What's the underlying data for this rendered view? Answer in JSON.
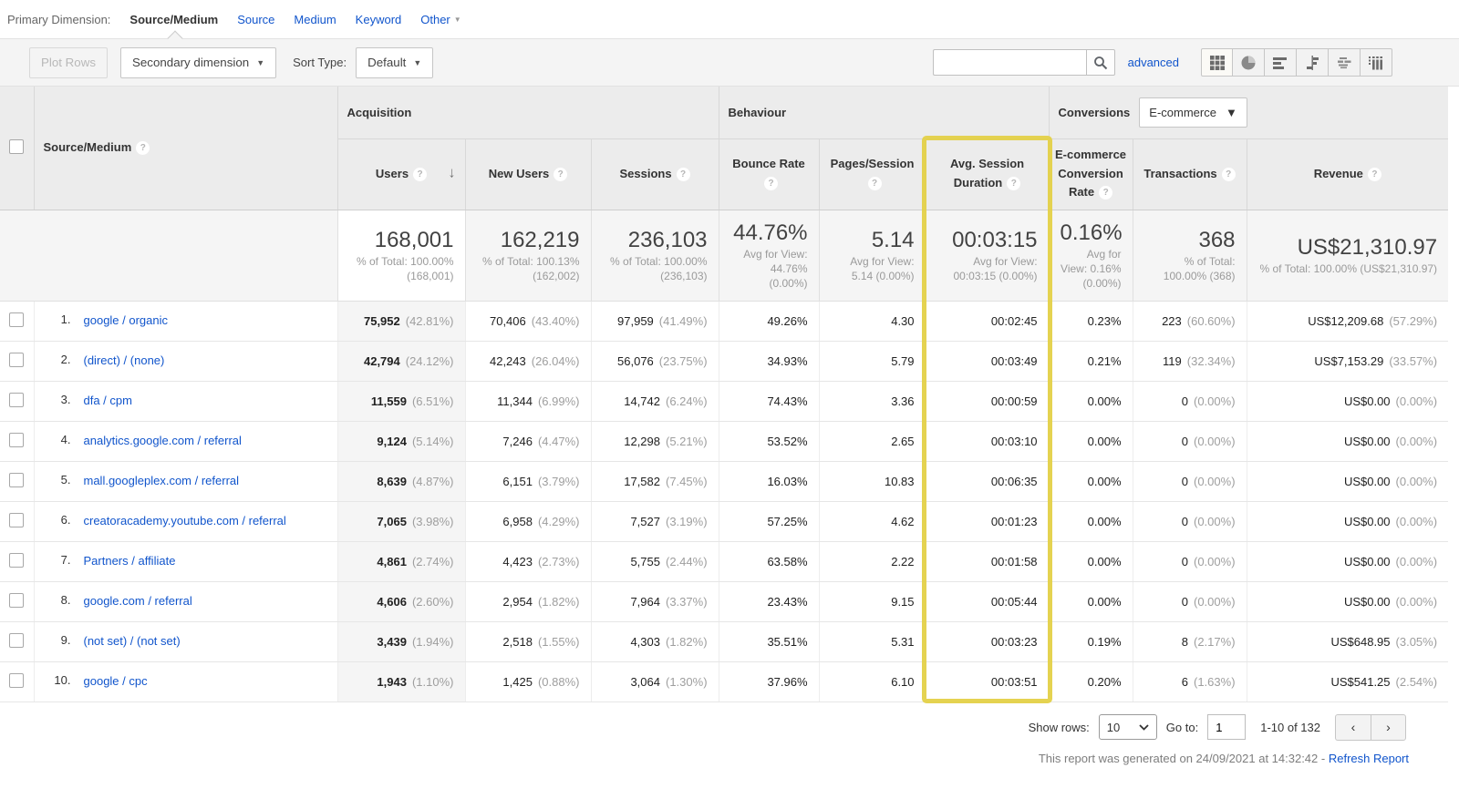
{
  "colors": {
    "highlight": "#e4d148",
    "link": "#1155cc",
    "header_bg": "#ececec"
  },
  "primary_dimension": {
    "label": "Primary Dimension:",
    "selected": "Source/Medium",
    "links": {
      "source": "Source",
      "medium": "Medium",
      "keyword": "Keyword",
      "other": "Other"
    }
  },
  "toolbar": {
    "plot_rows": "Plot Rows",
    "secondary_dimension": "Secondary dimension",
    "sort_type_label": "Sort Type:",
    "sort_type_value": "Default",
    "search_value": "",
    "advanced": "advanced",
    "view_icons": [
      "table-view-icon",
      "percentage-view-icon",
      "performance-view-icon",
      "comparison-view-icon",
      "term-cloud-icon",
      "pivot-view-icon"
    ]
  },
  "table": {
    "groups": {
      "acquisition": "Acquisition",
      "behaviour": "Behaviour",
      "conversions": "Conversions",
      "conversions_selector": "E-commerce"
    },
    "dimension_header": "Source/Medium",
    "headers": {
      "users": "Users",
      "new_users": "New Users",
      "sessions": "Sessions",
      "bounce": "Bounce Rate",
      "pages": "Pages/Session",
      "duration": "Avg. Session Duration",
      "ecom_rate": "E-commerce Conversion Rate",
      "transactions": "Transactions",
      "revenue": "Revenue"
    },
    "totals": {
      "users": {
        "value": "168,001",
        "sub": "% of Total: 100.00% (168,001)"
      },
      "new_users": {
        "value": "162,219",
        "sub": "% of Total: 100.13% (162,002)"
      },
      "sessions": {
        "value": "236,103",
        "sub": "% of Total: 100.00% (236,103)"
      },
      "bounce": {
        "value": "44.76%",
        "sub": "Avg for View: 44.76% (0.00%)"
      },
      "pages": {
        "value": "5.14",
        "sub": "Avg for View: 5.14 (0.00%)"
      },
      "duration": {
        "value": "00:03:15",
        "sub": "Avg for View: 00:03:15 (0.00%)"
      },
      "ecom_rate": {
        "value": "0.16%",
        "sub": "Avg for View: 0.16% (0.00%)"
      },
      "transactions": {
        "value": "368",
        "sub": "% of Total: 100.00% (368)"
      },
      "revenue": {
        "value": "US$21,310.97",
        "sub": "% of Total: 100.00% (US$21,310.97)"
      }
    },
    "rows": [
      {
        "num": "1.",
        "label": "google / organic",
        "users": "75,952",
        "users_pct": "(42.81%)",
        "new_users": "70,406",
        "new_users_pct": "(43.40%)",
        "sessions": "97,959",
        "sessions_pct": "(41.49%)",
        "bounce": "49.26%",
        "pages": "4.30",
        "duration": "00:02:45",
        "ecom_rate": "0.23%",
        "transactions": "223",
        "transactions_pct": "(60.60%)",
        "revenue": "US$12,209.68",
        "revenue_pct": "(57.29%)"
      },
      {
        "num": "2.",
        "label": "(direct) / (none)",
        "users": "42,794",
        "users_pct": "(24.12%)",
        "new_users": "42,243",
        "new_users_pct": "(26.04%)",
        "sessions": "56,076",
        "sessions_pct": "(23.75%)",
        "bounce": "34.93%",
        "pages": "5.79",
        "duration": "00:03:49",
        "ecom_rate": "0.21%",
        "transactions": "119",
        "transactions_pct": "(32.34%)",
        "revenue": "US$7,153.29",
        "revenue_pct": "(33.57%)"
      },
      {
        "num": "3.",
        "label": "dfa / cpm",
        "users": "11,559",
        "users_pct": "(6.51%)",
        "new_users": "11,344",
        "new_users_pct": "(6.99%)",
        "sessions": "14,742",
        "sessions_pct": "(6.24%)",
        "bounce": "74.43%",
        "pages": "3.36",
        "duration": "00:00:59",
        "ecom_rate": "0.00%",
        "transactions": "0",
        "transactions_pct": "(0.00%)",
        "revenue": "US$0.00",
        "revenue_pct": "(0.00%)"
      },
      {
        "num": "4.",
        "label": "analytics.google.com / referral",
        "users": "9,124",
        "users_pct": "(5.14%)",
        "new_users": "7,246",
        "new_users_pct": "(4.47%)",
        "sessions": "12,298",
        "sessions_pct": "(5.21%)",
        "bounce": "53.52%",
        "pages": "2.65",
        "duration": "00:03:10",
        "ecom_rate": "0.00%",
        "transactions": "0",
        "transactions_pct": "(0.00%)",
        "revenue": "US$0.00",
        "revenue_pct": "(0.00%)"
      },
      {
        "num": "5.",
        "label": "mall.googleplex.com / referral",
        "users": "8,639",
        "users_pct": "(4.87%)",
        "new_users": "6,151",
        "new_users_pct": "(3.79%)",
        "sessions": "17,582",
        "sessions_pct": "(7.45%)",
        "bounce": "16.03%",
        "pages": "10.83",
        "duration": "00:06:35",
        "ecom_rate": "0.00%",
        "transactions": "0",
        "transactions_pct": "(0.00%)",
        "revenue": "US$0.00",
        "revenue_pct": "(0.00%)"
      },
      {
        "num": "6.",
        "label": "creatoracademy.youtube.com / referral",
        "users": "7,065",
        "users_pct": "(3.98%)",
        "new_users": "6,958",
        "new_users_pct": "(4.29%)",
        "sessions": "7,527",
        "sessions_pct": "(3.19%)",
        "bounce": "57.25%",
        "pages": "4.62",
        "duration": "00:01:23",
        "ecom_rate": "0.00%",
        "transactions": "0",
        "transactions_pct": "(0.00%)",
        "revenue": "US$0.00",
        "revenue_pct": "(0.00%)"
      },
      {
        "num": "7.",
        "label": "Partners / affiliate",
        "users": "4,861",
        "users_pct": "(2.74%)",
        "new_users": "4,423",
        "new_users_pct": "(2.73%)",
        "sessions": "5,755",
        "sessions_pct": "(2.44%)",
        "bounce": "63.58%",
        "pages": "2.22",
        "duration": "00:01:58",
        "ecom_rate": "0.00%",
        "transactions": "0",
        "transactions_pct": "(0.00%)",
        "revenue": "US$0.00",
        "revenue_pct": "(0.00%)"
      },
      {
        "num": "8.",
        "label": "google.com / referral",
        "users": "4,606",
        "users_pct": "(2.60%)",
        "new_users": "2,954",
        "new_users_pct": "(1.82%)",
        "sessions": "7,964",
        "sessions_pct": "(3.37%)",
        "bounce": "23.43%",
        "pages": "9.15",
        "duration": "00:05:44",
        "ecom_rate": "0.00%",
        "transactions": "0",
        "transactions_pct": "(0.00%)",
        "revenue": "US$0.00",
        "revenue_pct": "(0.00%)"
      },
      {
        "num": "9.",
        "label": "(not set) / (not set)",
        "users": "3,439",
        "users_pct": "(1.94%)",
        "new_users": "2,518",
        "new_users_pct": "(1.55%)",
        "sessions": "4,303",
        "sessions_pct": "(1.82%)",
        "bounce": "35.51%",
        "pages": "5.31",
        "duration": "00:03:23",
        "ecom_rate": "0.19%",
        "transactions": "8",
        "transactions_pct": "(2.17%)",
        "revenue": "US$648.95",
        "revenue_pct": "(3.05%)"
      },
      {
        "num": "10.",
        "label": "google / cpc",
        "users": "1,943",
        "users_pct": "(1.10%)",
        "new_users": "1,425",
        "new_users_pct": "(0.88%)",
        "sessions": "3,064",
        "sessions_pct": "(1.30%)",
        "bounce": "37.96%",
        "pages": "6.10",
        "duration": "00:03:51",
        "ecom_rate": "0.20%",
        "transactions": "6",
        "transactions_pct": "(1.63%)",
        "revenue": "US$541.25",
        "revenue_pct": "(2.54%)"
      }
    ]
  },
  "footer": {
    "show_rows_label": "Show rows:",
    "show_rows_value": "10",
    "goto_label": "Go to:",
    "goto_value": "1",
    "range": "1-10 of 132",
    "generated": "This report was generated on 24/09/2021 at 14:32:42 -",
    "refresh": "Refresh Report"
  }
}
